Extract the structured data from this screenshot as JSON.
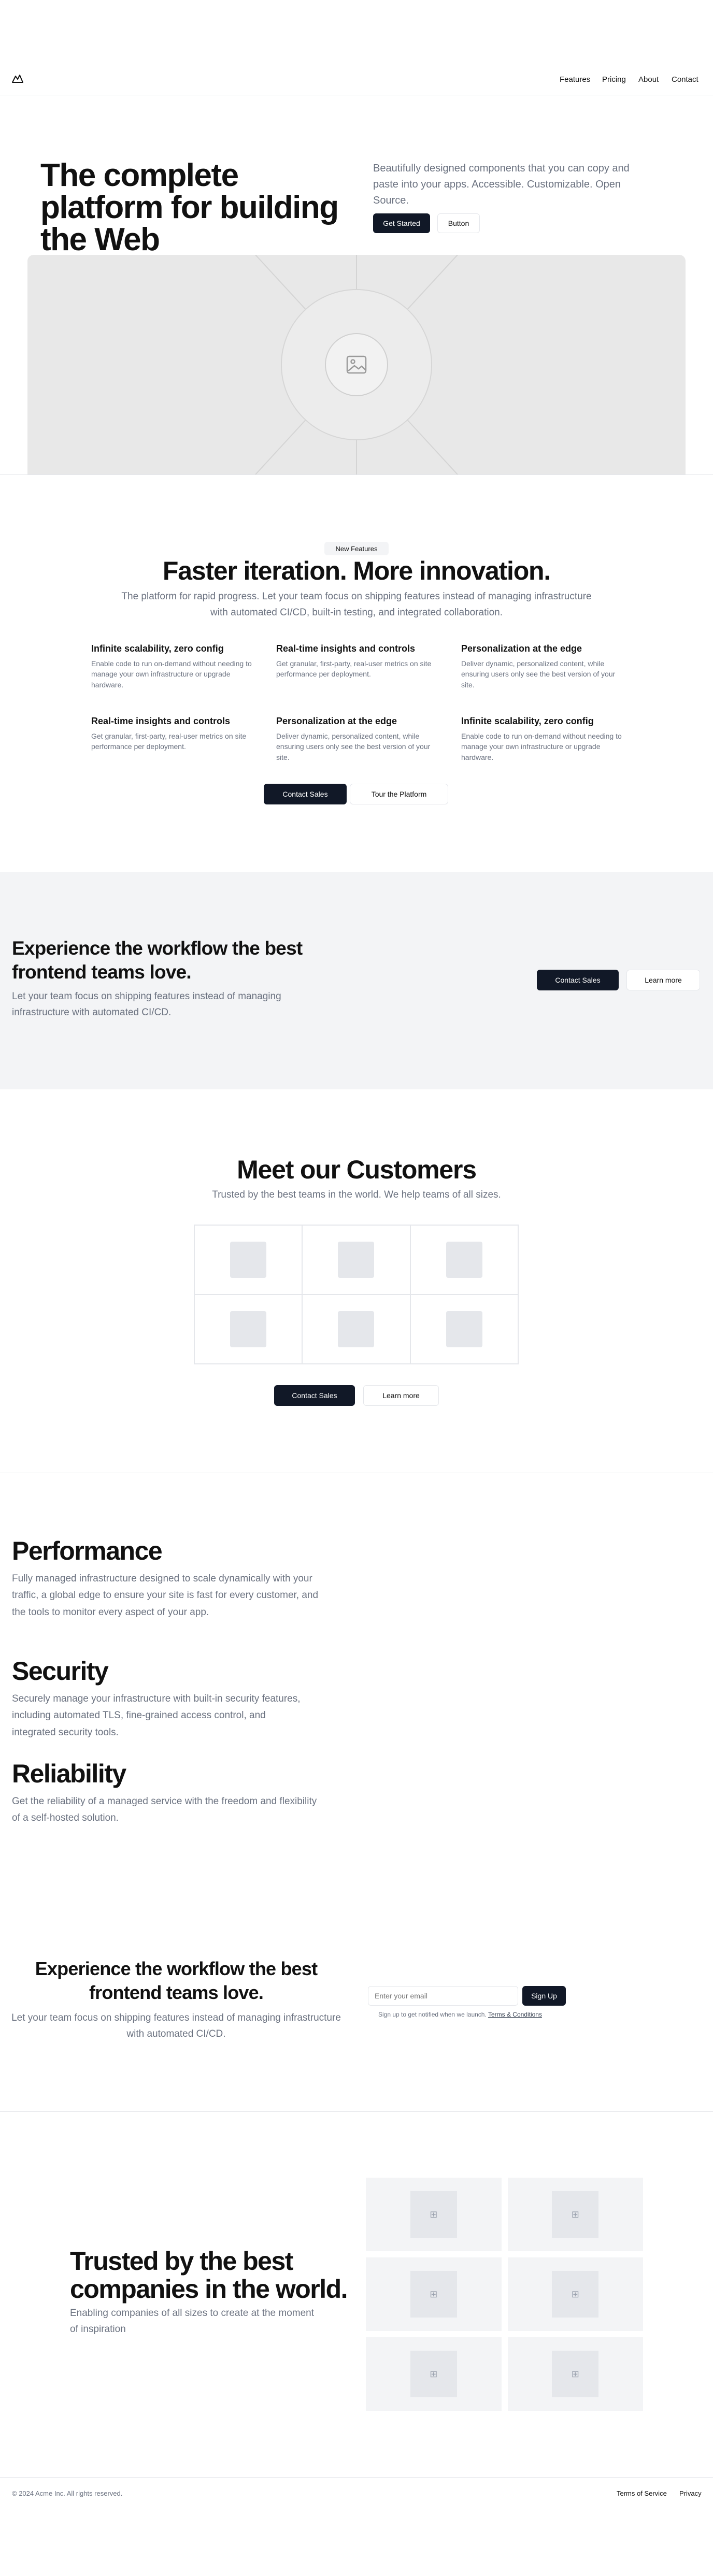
{
  "nav": {
    "logo_icon": "mountain-icon",
    "links": [
      "Features",
      "Pricing",
      "About",
      "Contact"
    ]
  },
  "hero": {
    "title": "The complete platform for building the Web",
    "subtitle": "Beautifully designed components that you can copy and paste into your apps. Accessible. Customizable. Open Source.",
    "primary_button": "Get Started",
    "secondary_button": "Button",
    "image_icon": "image-placeholder-icon"
  },
  "features": {
    "badge": "New Features",
    "title": "Faster iteration. More innovation.",
    "subtitle": "The platform for rapid progress. Let your team focus on shipping features instead of managing infrastructure with automated CI/CD, built-in testing, and integrated collaboration.",
    "items": [
      {
        "title": "Infinite scalability, zero config",
        "desc": "Enable code to run on-demand without needing to manage your own infrastructure or upgrade hardware."
      },
      {
        "title": "Real-time insights and controls",
        "desc": "Get granular, first-party, real-user metrics on site performance per deployment."
      },
      {
        "title": "Personalization at the edge",
        "desc": "Deliver dynamic, personalized content, while ensuring users only see the best version of your site."
      },
      {
        "title": "Real-time insights and controls",
        "desc": "Get granular, first-party, real-user metrics on site performance per deployment."
      },
      {
        "title": "Personalization at the edge",
        "desc": "Deliver dynamic, personalized content, while ensuring users only see the best version of your site."
      },
      {
        "title": "Infinite scalability, zero config",
        "desc": "Enable code to run on-demand without needing to manage your own infrastructure or upgrade hardware."
      }
    ],
    "primary_button": "Contact Sales",
    "secondary_button": "Tour the Platform"
  },
  "workflow": {
    "title": "Experience the workflow the best frontend teams love.",
    "subtitle": "Let your team focus on shipping features instead of managing infrastructure with automated CI/CD.",
    "primary_button": "Contact Sales",
    "secondary_button": "Learn more"
  },
  "customers": {
    "title": "Meet our Customers",
    "subtitle": "Trusted by the best teams in the world. We help teams of all sizes.",
    "primary_button": "Contact Sales",
    "secondary_button": "Learn more"
  },
  "pillars": [
    {
      "title": "Performance",
      "desc": "Fully managed infrastructure designed to scale dynamically with your traffic, a global edge to ensure your site is fast for every customer, and the tools to monitor every aspect of your app."
    },
    {
      "title": "Security",
      "desc": "Securely manage your infrastructure with built-in security features, including automated TLS, fine-grained access control, and integrated security tools."
    },
    {
      "title": "Reliability",
      "desc": "Get the reliability of a managed service with the freedom and flexibility of a self-hosted solution."
    }
  ],
  "signup": {
    "title": "Experience the workflow the best frontend teams love.",
    "subtitle": "Let your team focus on shipping features instead of managing infrastructure with automated CI/CD.",
    "email_placeholder": "Enter your email",
    "button": "Sign Up",
    "note": "Sign up to get notified when we launch.",
    "terms_link": "Terms & Conditions"
  },
  "trusted": {
    "title": "Trusted by the best companies in the world.",
    "subtitle": "Enabling companies of all sizes to create at the moment of inspiration"
  },
  "footer": {
    "copyright": "© 2024 Acme Inc. All rights reserved.",
    "links": [
      "Terms of Service",
      "Privacy"
    ]
  }
}
